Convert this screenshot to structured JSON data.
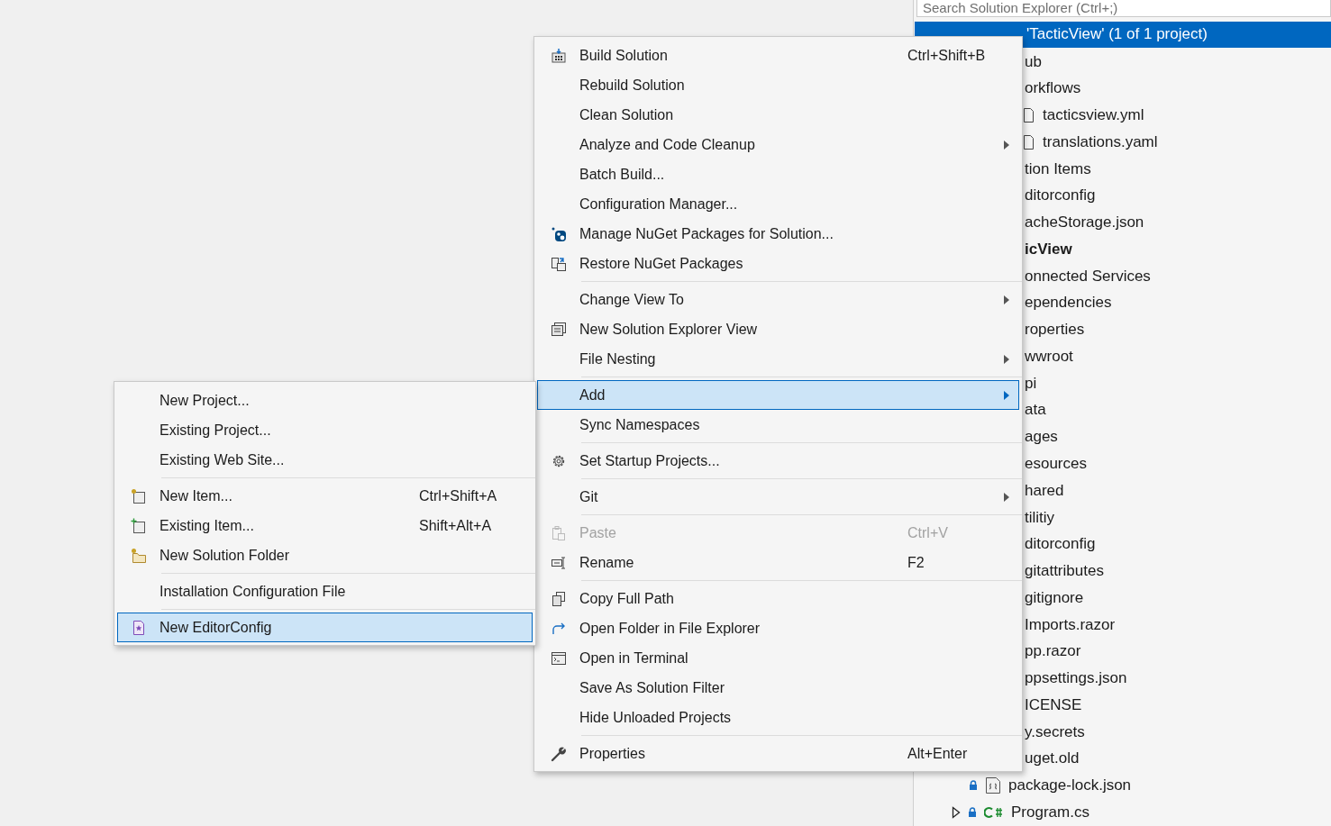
{
  "explorer": {
    "search": {
      "placeholder": "Search Solution Explorer (Ctrl+;)"
    },
    "solution": {
      "label": "'TacticView' (1 of 1 project)",
      "selected": true
    },
    "rows": [
      {
        "kind": "clipped",
        "text": "ub"
      },
      {
        "kind": "clipped",
        "text": "orkflows"
      },
      {
        "kind": "yaml",
        "text": "tacticsview.yml"
      },
      {
        "kind": "yaml",
        "text": "translations.yaml"
      },
      {
        "kind": "clipped",
        "text": "tion Items"
      },
      {
        "kind": "clipped",
        "text": "ditorconfig"
      },
      {
        "kind": "clipped",
        "text": "acheStorage.json"
      },
      {
        "kind": "project",
        "text": "icView"
      },
      {
        "kind": "clipped",
        "text": "onnected Services"
      },
      {
        "kind": "clipped",
        "text": "ependencies"
      },
      {
        "kind": "clipped",
        "text": "roperties"
      },
      {
        "kind": "clipped",
        "text": "wwroot"
      },
      {
        "kind": "clipped",
        "text": "pi"
      },
      {
        "kind": "clipped",
        "text": "ata"
      },
      {
        "kind": "clipped",
        "text": "ages"
      },
      {
        "kind": "clipped",
        "text": "esources"
      },
      {
        "kind": "clipped",
        "text": "hared"
      },
      {
        "kind": "clipped",
        "text": "tilitiy"
      },
      {
        "kind": "clipped",
        "text": "ditorconfig"
      },
      {
        "kind": "clipped",
        "text": "gitattributes"
      },
      {
        "kind": "clipped",
        "text": "gitignore"
      },
      {
        "kind": "clipped",
        "text": "Imports.razor"
      },
      {
        "kind": "clipped",
        "text": "pp.razor"
      },
      {
        "kind": "clipped",
        "text": "ppsettings.json"
      },
      {
        "kind": "clipped",
        "text": "ICENSE"
      },
      {
        "kind": "clipped",
        "text": "y.secrets"
      },
      {
        "kind": "clipped",
        "text": "uget.old"
      },
      {
        "kind": "json",
        "text": "package-lock.json"
      },
      {
        "kind": "csharp",
        "text": "Program.cs"
      }
    ]
  },
  "context_menu": {
    "items": [
      {
        "kind": "item",
        "label": "Build Solution",
        "shortcut": "Ctrl+Shift+B",
        "submenu": false,
        "disabled": false,
        "selected": false
      },
      {
        "kind": "item",
        "label": "Rebuild Solution",
        "submenu": false,
        "disabled": false,
        "selected": false
      },
      {
        "kind": "item",
        "label": "Clean Solution",
        "submenu": false,
        "disabled": false,
        "selected": false
      },
      {
        "kind": "item",
        "label": "Analyze and Code Cleanup",
        "submenu": true,
        "disabled": false,
        "selected": false
      },
      {
        "kind": "item",
        "label": "Batch Build...",
        "submenu": false,
        "disabled": false,
        "selected": false
      },
      {
        "kind": "item",
        "label": "Configuration Manager...",
        "submenu": false,
        "disabled": false,
        "selected": false
      },
      {
        "kind": "item",
        "label": "Manage NuGet Packages for Solution...",
        "submenu": false,
        "disabled": false,
        "selected": false
      },
      {
        "kind": "item",
        "label": "Restore NuGet Packages",
        "submenu": false,
        "disabled": false,
        "selected": false
      },
      {
        "kind": "separator"
      },
      {
        "kind": "item",
        "label": "Change View To",
        "submenu": true,
        "disabled": false,
        "selected": false
      },
      {
        "kind": "item",
        "label": "New Solution Explorer View",
        "submenu": false,
        "disabled": false,
        "selected": false
      },
      {
        "kind": "item",
        "label": "File Nesting",
        "submenu": true,
        "disabled": false,
        "selected": false
      },
      {
        "kind": "separator"
      },
      {
        "kind": "item",
        "label": "Add",
        "submenu": true,
        "disabled": false,
        "selected": true
      },
      {
        "kind": "item",
        "label": "Sync Namespaces",
        "submenu": false,
        "disabled": false,
        "selected": false
      },
      {
        "kind": "separator"
      },
      {
        "kind": "item",
        "label": "Set Startup Projects...",
        "submenu": false,
        "disabled": false,
        "selected": false
      },
      {
        "kind": "separator"
      },
      {
        "kind": "item",
        "label": "Git",
        "submenu": true,
        "disabled": false,
        "selected": false
      },
      {
        "kind": "separator"
      },
      {
        "kind": "item",
        "label": "Paste",
        "shortcut": "Ctrl+V",
        "submenu": false,
        "disabled": true,
        "selected": false
      },
      {
        "kind": "item",
        "label": "Rename",
        "shortcut": "F2",
        "submenu": false,
        "disabled": false,
        "selected": false
      },
      {
        "kind": "separator"
      },
      {
        "kind": "item",
        "label": "Copy Full Path",
        "submenu": false,
        "disabled": false,
        "selected": false
      },
      {
        "kind": "item",
        "label": "Open Folder in File Explorer",
        "submenu": false,
        "disabled": false,
        "selected": false
      },
      {
        "kind": "item",
        "label": "Open in Terminal",
        "submenu": false,
        "disabled": false,
        "selected": false
      },
      {
        "kind": "item",
        "label": "Save As Solution Filter",
        "submenu": false,
        "disabled": false,
        "selected": false
      },
      {
        "kind": "item",
        "label": "Hide Unloaded Projects",
        "submenu": false,
        "disabled": false,
        "selected": false
      },
      {
        "kind": "separator"
      },
      {
        "kind": "item",
        "label": "Properties",
        "shortcut": "Alt+Enter",
        "submenu": false,
        "disabled": false,
        "selected": false
      }
    ]
  },
  "add_submenu": {
    "items": [
      {
        "kind": "item",
        "label": "New Project...",
        "submenu": false,
        "disabled": false,
        "selected": false
      },
      {
        "kind": "item",
        "label": "Existing Project...",
        "submenu": false,
        "disabled": false,
        "selected": false
      },
      {
        "kind": "item",
        "label": "Existing Web Site...",
        "submenu": false,
        "disabled": false,
        "selected": false
      },
      {
        "kind": "separator"
      },
      {
        "kind": "item",
        "label": "New Item...",
        "shortcut": "Ctrl+Shift+A",
        "submenu": false,
        "disabled": false,
        "selected": false
      },
      {
        "kind": "item",
        "label": "Existing Item...",
        "shortcut": "Shift+Alt+A",
        "submenu": false,
        "disabled": false,
        "selected": false
      },
      {
        "kind": "item",
        "label": "New Solution Folder",
        "submenu": false,
        "disabled": false,
        "selected": false
      },
      {
        "kind": "separator"
      },
      {
        "kind": "item",
        "label": "Installation Configuration File",
        "submenu": false,
        "disabled": false,
        "selected": false
      },
      {
        "kind": "separator"
      },
      {
        "kind": "item",
        "label": "New EditorConfig",
        "submenu": false,
        "disabled": false,
        "selected": true
      }
    ]
  }
}
